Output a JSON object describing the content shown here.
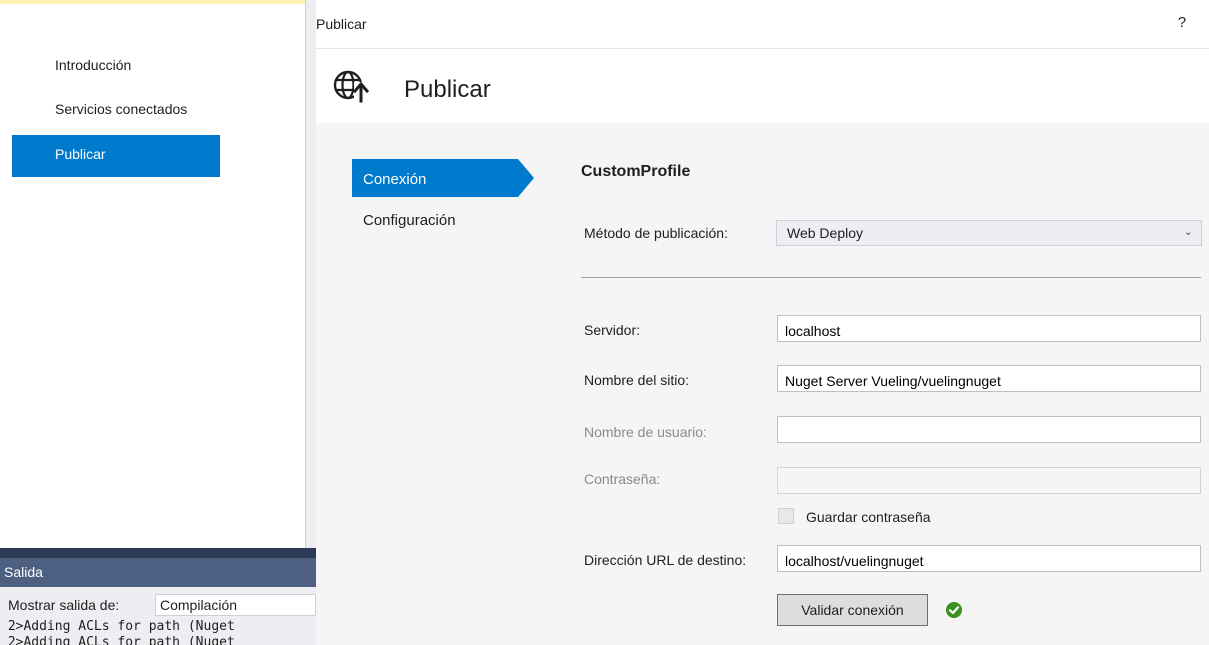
{
  "background_window": {
    "nav_items": [
      {
        "label": "Introducción"
      },
      {
        "label": "Servicios conectados"
      },
      {
        "label": "Publicar",
        "selected": true
      }
    ],
    "output": {
      "title": "Salida",
      "show_output_from_label": "Mostrar salida de:",
      "source": "Compilación",
      "log_lines": [
        " 2>Adding ACLs for path (Nuget",
        " 2>Adding ACLs for path (Nuget"
      ]
    }
  },
  "dialog": {
    "title": "Publicar",
    "help_label": "?",
    "heading": "Publicar",
    "steps": [
      {
        "label": "Conexión",
        "active": true
      },
      {
        "label": "Configuración",
        "active": false
      }
    ],
    "profile_name": "CustomProfile",
    "form": {
      "method_label": "Método de publicación:",
      "method_value": "Web Deploy",
      "server_label": "Servidor:",
      "server_value": "localhost",
      "site_label": "Nombre del sitio:",
      "site_value": "Nuget Server Vueling/vuelingnuget",
      "user_label": "Nombre de usuario:",
      "user_value": "",
      "password_label": "Contraseña:",
      "password_value": "",
      "save_password_label": "Guardar contraseña",
      "save_password_checked": false,
      "url_label": "Dirección URL de destino:",
      "url_value": "localhost/vuelingnuget",
      "validate_button_label": "Validar conexión",
      "validation_status": "success"
    }
  },
  "colors": {
    "accent": "#007acc",
    "success": "#3a8f1e",
    "output_header": "#4d6082"
  },
  "icons": {
    "publish": "globe-upload-icon",
    "dropdown": "chevron-down-icon",
    "validation": "check-circle-icon"
  }
}
